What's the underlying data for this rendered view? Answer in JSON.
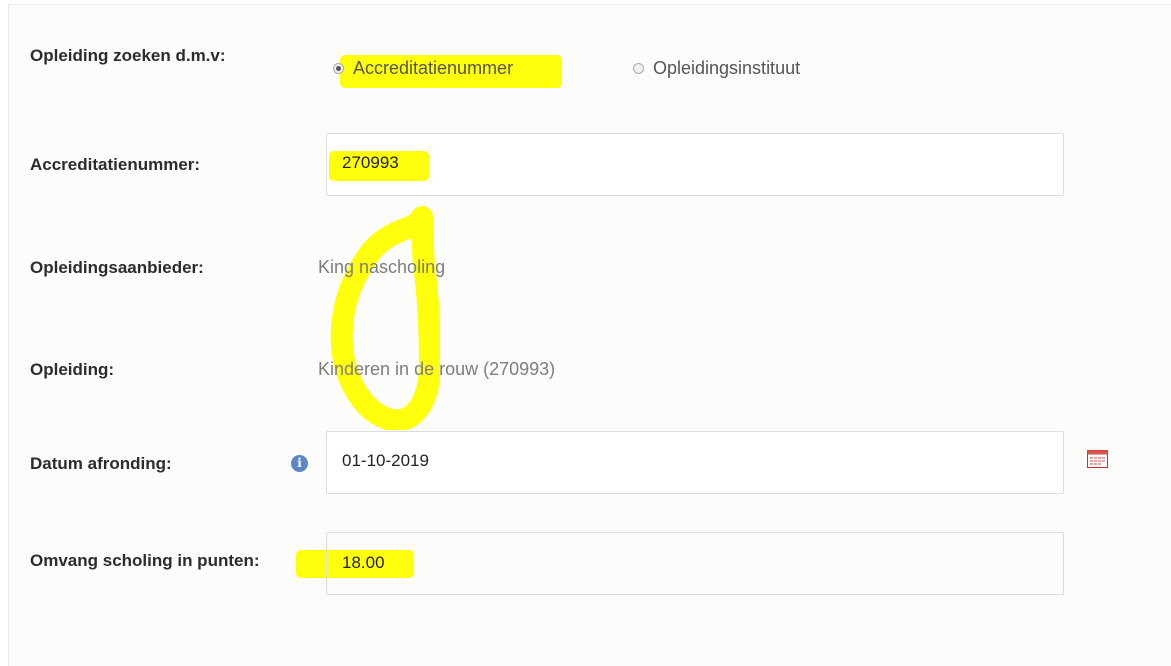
{
  "search": {
    "label": "Opleiding zoeken d.m.v:",
    "options": [
      {
        "label": "Accreditatienummer",
        "checked": true
      },
      {
        "label": "Opleidingsinstituut",
        "checked": false
      }
    ]
  },
  "accreditation": {
    "label": "Accreditatienummer:",
    "value": "270993"
  },
  "provider": {
    "label": "Opleidingsaanbieder:",
    "value": "King nascholing"
  },
  "course": {
    "label": "Opleiding:",
    "value": "Kinderen in de rouw (270993)"
  },
  "completion_date": {
    "label": "Datum afronding:",
    "value": "01-10-2019",
    "info_icon": "info-icon",
    "calendar_icon": "calendar-icon"
  },
  "points": {
    "label": "Omvang scholing in punten:",
    "value": "18.00"
  },
  "colors": {
    "highlight": "#ffff00",
    "info_icon": "#5b86c9",
    "calendar_icon": "#d9534f"
  }
}
